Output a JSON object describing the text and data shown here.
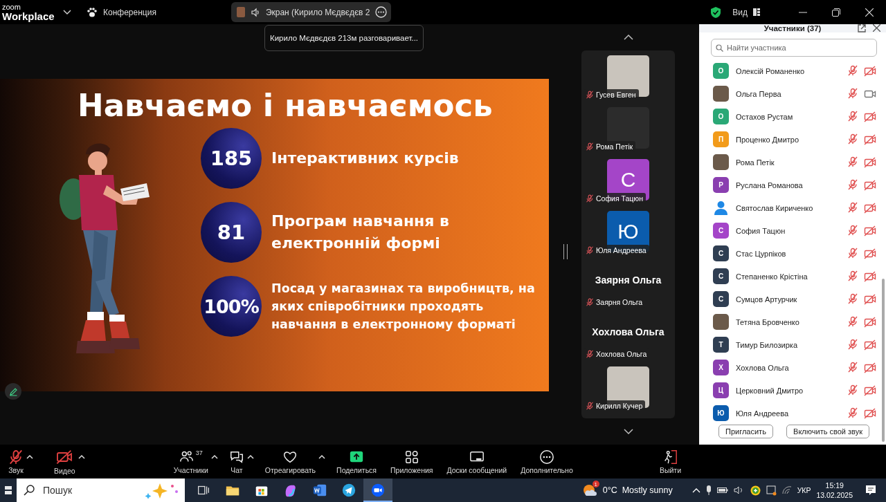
{
  "titlebar": {
    "logo_top": "zoom",
    "logo": "Workplace",
    "meeting": "Конференция",
    "share_pill": "Экран (Кирило Мєдвєдєв 2",
    "view": "Вид"
  },
  "tooltip": "Кирило Мєдвєдєв 213м разговаривает...",
  "slide": {
    "title": "Навчаємо і навчаємось",
    "stats": [
      {
        "number": "185",
        "text": "Інтерактивних курсів",
        "kind": "large"
      },
      {
        "number": "81",
        "text": "Програм навчання в електронній формі",
        "kind": "large"
      },
      {
        "number": "100%",
        "text": "Посад у магазинах та виробництв, на яких співробітники проходять навчання в електронному форматі",
        "kind": "small"
      }
    ]
  },
  "thumbnails": [
    {
      "kind": "video",
      "name": "Гусев Евген",
      "muted": true
    },
    {
      "kind": "video",
      "name": "Рома Петік",
      "muted": true
    },
    {
      "kind": "initial",
      "initial": "С",
      "color": "#a445c8",
      "name": "София Тацюн",
      "muted": true
    },
    {
      "kind": "initial",
      "initial": "Ю",
      "color": "#0b5cad",
      "name": "Юля Андреева",
      "muted": true
    },
    {
      "kind": "name",
      "title": "Заярня Ольга",
      "name": "Заярня Ольга",
      "muted": true
    },
    {
      "kind": "name",
      "title": "Хохлова Ольга",
      "name": "Хохлова Ольга",
      "muted": true
    },
    {
      "kind": "video",
      "name": "Кирилл Кучер",
      "muted": true
    }
  ],
  "panel": {
    "title": "Участники (37)",
    "search_placeholder": "Найти участника",
    "participants": [
      {
        "kind": "initial",
        "initial": "О",
        "color": "#2aa876",
        "name": "Олексій Романенко",
        "muted": true,
        "video_on": false
      },
      {
        "kind": "photo",
        "name": "Ольга Перва",
        "muted": true,
        "video_on": true
      },
      {
        "kind": "initial",
        "initial": "О",
        "color": "#2aa876",
        "name": "Остахов Рустам",
        "muted": true,
        "video_on": false
      },
      {
        "kind": "initial",
        "initial": "П",
        "color": "#f29b1a",
        "name": "Проценко Дмитро",
        "muted": true,
        "video_on": false
      },
      {
        "kind": "photo",
        "name": "Рома Петік",
        "muted": true,
        "video_on": false
      },
      {
        "kind": "initial",
        "initial": "Р",
        "color": "#8a3fb0",
        "name": "Руслана Романова",
        "muted": true,
        "video_on": false
      },
      {
        "kind": "silhouette",
        "name": "Святослав Кириченко",
        "muted": true,
        "video_on": false
      },
      {
        "kind": "initial",
        "initial": "С",
        "color": "#a445c8",
        "name": "София Тацюн",
        "muted": true,
        "video_on": false
      },
      {
        "kind": "initial",
        "initial": "С",
        "color": "#2f3e52",
        "name": "Стас Цурпіков",
        "muted": true,
        "video_on": false
      },
      {
        "kind": "initial",
        "initial": "С",
        "color": "#2f3e52",
        "name": "Степаненко Крістіна",
        "muted": true,
        "video_on": false
      },
      {
        "kind": "initial",
        "initial": "С",
        "color": "#2f3e52",
        "name": "Сумцов Артурчик",
        "muted": true,
        "video_on": false
      },
      {
        "kind": "photo",
        "name": "Тетяна Бровченко",
        "muted": true,
        "video_on": false
      },
      {
        "kind": "initial",
        "initial": "Т",
        "color": "#2f3e52",
        "name": "Тимур Билозирка",
        "muted": true,
        "video_on": false
      },
      {
        "kind": "initial",
        "initial": "Х",
        "color": "#8a3fb0",
        "name": "Хохлова Ольга",
        "muted": true,
        "video_on": false
      },
      {
        "kind": "initial",
        "initial": "Ц",
        "color": "#8a3fb0",
        "name": "Церковний Дмитро",
        "muted": true,
        "video_on": false
      },
      {
        "kind": "initial",
        "initial": "Ю",
        "color": "#0b5cad",
        "name": "Юля Андреева",
        "muted": true,
        "video_on": false
      }
    ],
    "buttons": [
      "Пригласить",
      "Включить свой звук"
    ]
  },
  "toolbar": {
    "audio": {
      "label": "Звук",
      "muted": true
    },
    "video": {
      "label": "Видео",
      "on": false
    },
    "items": [
      {
        "label": "Участники",
        "count": "37",
        "caret": true
      },
      {
        "label": "Чат",
        "caret": true
      },
      {
        "label": "Отреагировать",
        "caret": true
      },
      {
        "label": "Поделиться",
        "caret": false
      },
      {
        "label": "Приложения",
        "caret": false
      },
      {
        "label": "Доски сообщений",
        "caret": false
      },
      {
        "label": "Дополнительно",
        "caret": false
      }
    ],
    "leave": "Выйти"
  },
  "taskbar": {
    "search_placeholder": "Пошук",
    "apps": [
      {
        "selected": false
      },
      {
        "selected": false
      },
      {
        "selected": false
      },
      {
        "selected": false
      },
      {
        "selected": false
      },
      {
        "selected": false
      },
      {
        "selected": true
      }
    ],
    "weather_badge": "1",
    "weather": "0°C  Mostly sunny",
    "language": "УКР",
    "time": "15:19",
    "date": "13.02.2025"
  }
}
